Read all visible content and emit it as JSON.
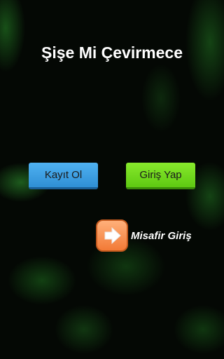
{
  "title": "Şişe Mi Çevirmece",
  "buttons": {
    "register": "Kayıt Ol",
    "login": "Giriş Yap"
  },
  "guest": {
    "label": "Misafir Giriş",
    "icon": "arrow-right-icon"
  },
  "colors": {
    "register": "#3a9fe2",
    "login": "#6fd91c",
    "guest_icon": "#f58c4a"
  }
}
